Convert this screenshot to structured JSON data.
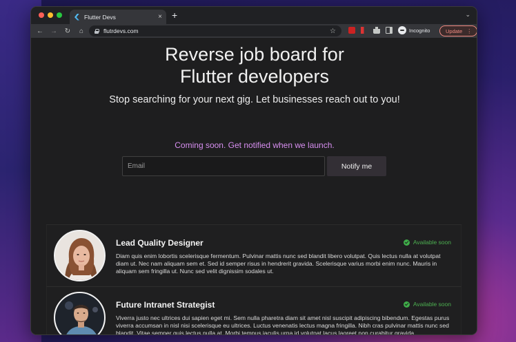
{
  "browser": {
    "tab_title": "Flutter Devs",
    "tab_close": "×",
    "new_tab": "+",
    "tab_menu": "⌄",
    "url": "flutrdevs.com",
    "incognito_label": "Incognito",
    "update_label": "Update",
    "update_menu": "⋮"
  },
  "hero": {
    "title_line1": "Reverse job board for",
    "title_line2": "Flutter developers",
    "subtitle": "Stop searching for your next gig. Let businesses reach out to you!"
  },
  "signup": {
    "coming_soon": "Coming soon. Get notified when we launch.",
    "email_placeholder": "Email",
    "notify_label": "Notify me"
  },
  "developers": [
    {
      "title": "Lead Quality Designer",
      "status": "Available soon",
      "description": "Diam quis enim lobortis scelerisque fermentum. Pulvinar mattis nunc sed blandit libero volutpat. Quis lectus nulla at volutpat diam ut. Nec nam aliquam sem et. Sed id semper risus in hendrerit gravida. Scelerisque varius morbi enim nunc. Mauris in aliquam sem fringilla ut. Nunc sed velit dignissim sodales ut."
    },
    {
      "title": "Future Intranet Strategist",
      "status": "Available soon",
      "description": "Viverra justo nec ultrices dui sapien eget mi. Sem nulla pharetra diam sit amet nisl suscipit adipiscing bibendum. Egestas purus viverra accumsan in nisl nisi scelerisque eu ultrices. Luctus venenatis lectus magna fringilla. Nibh cras pulvinar mattis nunc sed blandit. Vitae semper quis lectus nulla at. Morbi tempus iaculis urna id volutpat lacus laoreet non curabitur gravida."
    }
  ],
  "icons": {
    "back": "←",
    "forward": "→",
    "reload": "↻",
    "home": "⌂",
    "star": "☆"
  }
}
